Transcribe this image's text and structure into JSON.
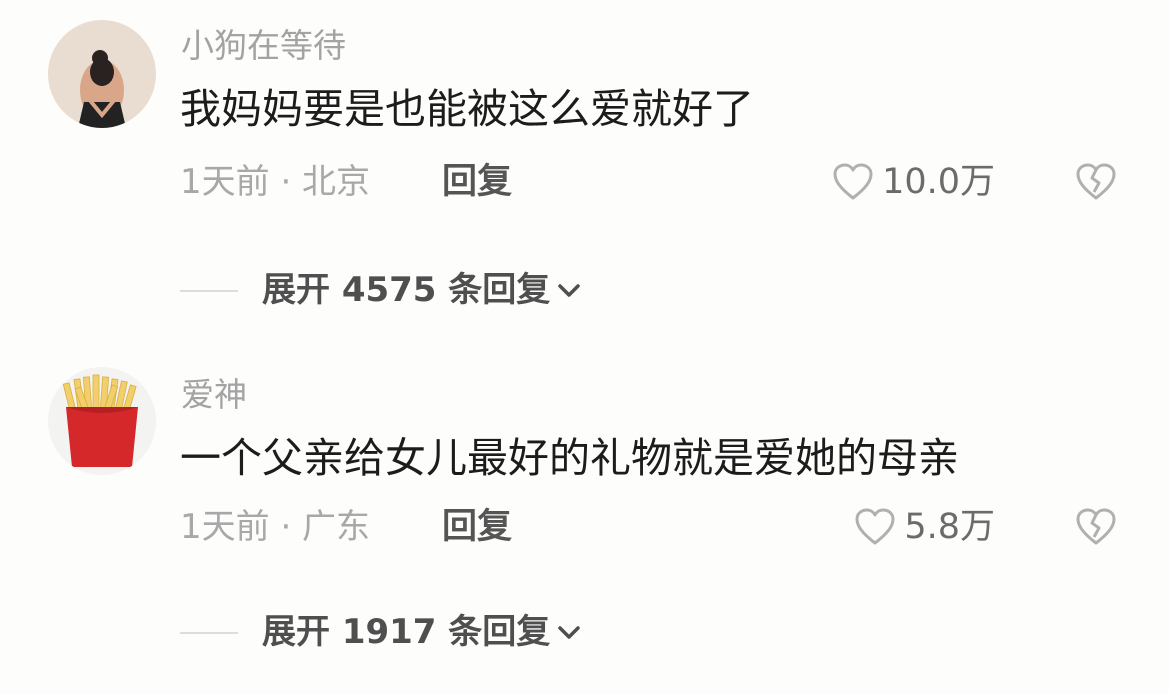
{
  "comments": [
    {
      "username": "小狗在等待",
      "text": "我妈妈要是也能被这么爱就好了",
      "meta": "1天前 · 北京",
      "reply_label": "回复",
      "like_count": "10.0万",
      "expand_label": "展开 4575 条回复",
      "avatar": "girl-back-photo"
    },
    {
      "username": "爱神",
      "text": "一个父亲给女儿最好的礼物就是爱她的母亲",
      "meta": "1天前 · 广东",
      "reply_label": "回复",
      "like_count": "5.8万",
      "expand_label": "展开 1917 条回复",
      "avatar": "french-fries"
    }
  ],
  "icons": {
    "like": "heart-outline-icon",
    "dislike": "broken-heart-icon",
    "expand": "chevron-down-icon"
  },
  "colors": {
    "background": "#fdfdfb",
    "username": "#a3a3a3",
    "text": "#1c1c1c",
    "meta": "#a8a8a8",
    "fries_box": "#d4282a",
    "fries": "#f2cf6a"
  }
}
